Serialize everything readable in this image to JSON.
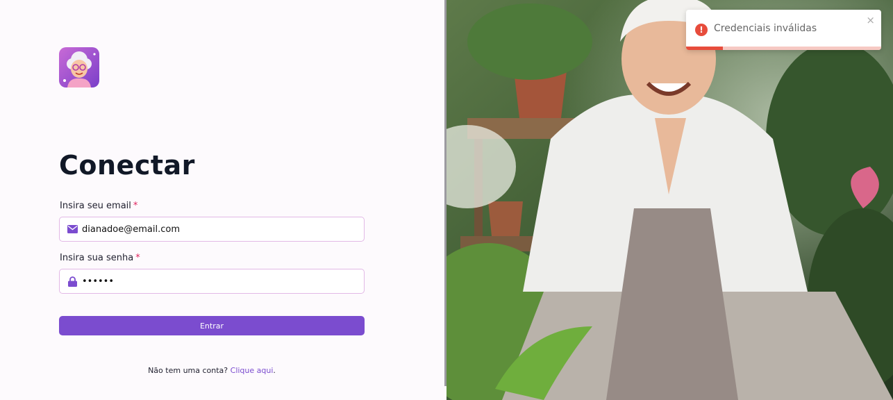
{
  "page": {
    "title": "Conectar"
  },
  "form": {
    "email_label": "Insira seu email",
    "email_required": "*",
    "email_value": "dianadoe@email.com",
    "password_label": "Insira sua senha",
    "password_required": "*",
    "password_value": "••••••",
    "submit_label": "Entrar"
  },
  "signup": {
    "prompt": "Não tem uma conta?",
    "link_label": "Clique aqui",
    "suffix": "."
  },
  "toast": {
    "message": "Credenciais inválidas",
    "icon": "error-icon",
    "close": "×",
    "progress": 0.19
  },
  "icons": {
    "logo": "grandma-avatar-logo",
    "email": "envelope-icon",
    "password": "lock-icon"
  },
  "colors": {
    "accent": "#7b4ccf",
    "required": "#e0245e",
    "error": "#e74c3c",
    "input_border": "#e2b8e6"
  }
}
